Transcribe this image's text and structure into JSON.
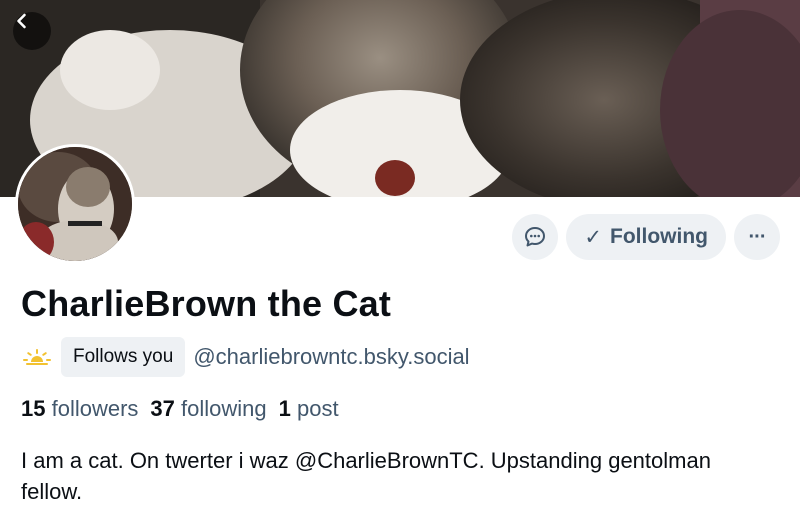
{
  "profile": {
    "display_name": "CharlieBrown the Cat",
    "handle": "@charliebrowntc.bsky.social",
    "follows_you_label": "Follows you",
    "bio": "I am  a cat.  On twerter i waz @CharlieBrownTC. Upstanding gentolman fellow."
  },
  "stats": {
    "followers_count": "15",
    "followers_label": "followers",
    "following_count": "37",
    "following_label": "following",
    "posts_count": "1",
    "posts_label": "post"
  },
  "actions": {
    "following_label": "Following",
    "following_check": "✓",
    "more_label": "···"
  },
  "icons": {
    "back": "chevron-left-icon",
    "message": "chat-bubble-icon",
    "badge": "sunrise-icon",
    "more": "ellipsis-icon"
  },
  "colors": {
    "muted_text": "#42576c",
    "button_bg": "#eef1f4",
    "badge_yellow": "#f2c230"
  }
}
